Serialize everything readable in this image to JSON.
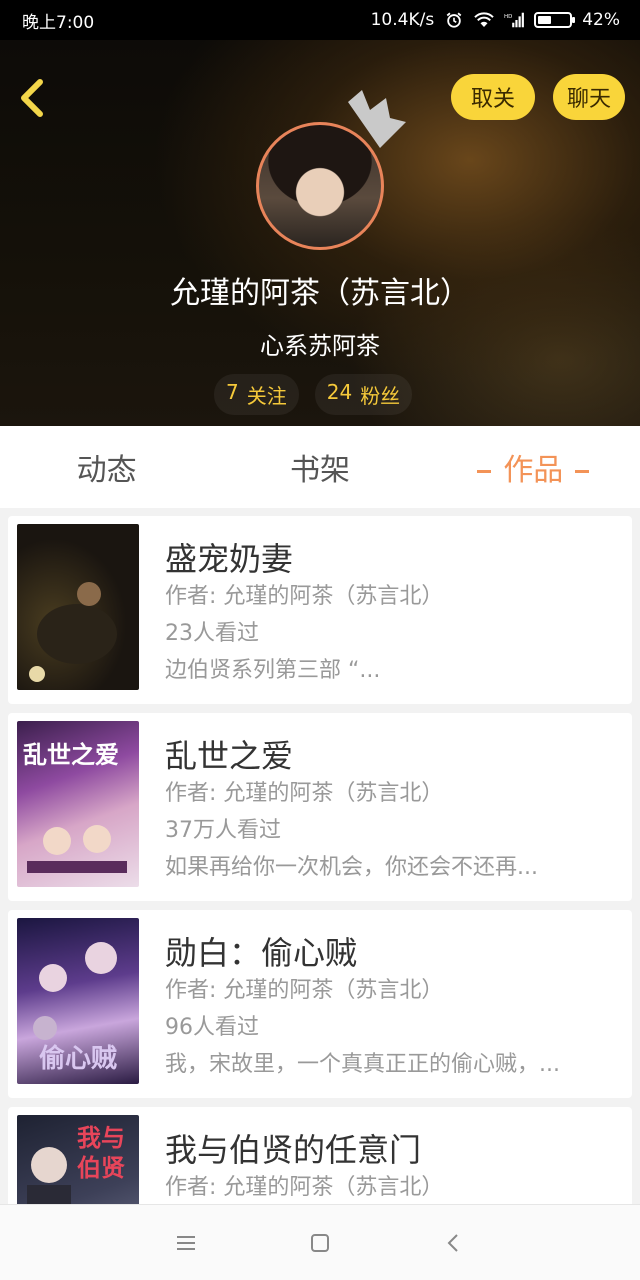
{
  "status_bar": {
    "time": "晚上7:00",
    "net_speed": "10.4K/s",
    "battery": "42%",
    "battery_level": 0.42
  },
  "header": {
    "unfollow_label": "取关",
    "chat_label": "聊天",
    "name": "允瑾的阿茶（苏言北）",
    "subtitle": "心系苏阿茶",
    "following_count": "7",
    "following_label": "关注",
    "fans_count": "24",
    "fans_label": "粉丝"
  },
  "tabs": [
    {
      "label": "动态",
      "active": false
    },
    {
      "label": "书架",
      "active": false
    },
    {
      "label": "作品",
      "active": true
    }
  ],
  "books": [
    {
      "title": "盛宠奶妻",
      "author": "作者: 允瑾的阿茶（苏言北）",
      "views": "23人看过",
      "desc": "边伯贤系列第三部 “..."
    },
    {
      "title": "乱世之爱",
      "author": "作者: 允瑾的阿茶（苏言北）",
      "views": "37万人看过",
      "desc": "如果再给你一次机会，你还会不还再..."
    },
    {
      "title": "勋白：偷心贼",
      "author": "作者: 允瑾的阿茶（苏言北）",
      "views": "96人看过",
      "desc": "我，宋故里，一个真真正正的偷心贼，..."
    },
    {
      "title": "我与伯贤的任意门",
      "author": "作者: 允瑾的阿茶（苏言北）",
      "views": "",
      "desc": ""
    }
  ],
  "covers": {
    "cover_2_text": "乱世之爱",
    "cover_3_text": "偷心贼",
    "cover_4_text": "我与伯贤"
  },
  "colors": {
    "accent": "#f39357",
    "button_yellow": "#f9d53a",
    "stat_text": "#f5c93a"
  }
}
